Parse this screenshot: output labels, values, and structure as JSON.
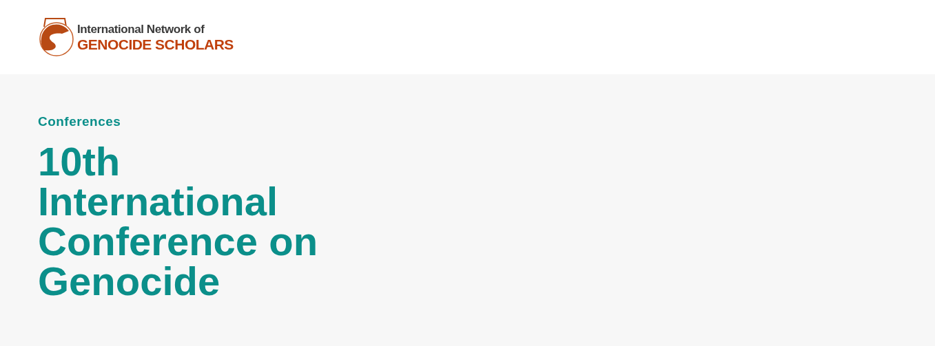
{
  "header": {
    "logo": {
      "line_1": "International Network of",
      "line_2": "GENOCIDE SCHOLARS"
    }
  },
  "hero": {
    "eyebrow": "Conferences",
    "title_lines": [
      "10th",
      "International",
      "Conference on",
      "Genocide"
    ]
  }
}
